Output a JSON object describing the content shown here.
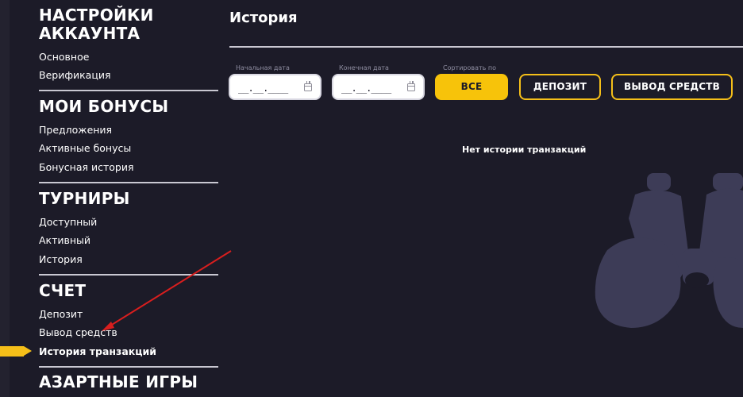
{
  "sidebar": {
    "sections": [
      {
        "title_line1": "НАСТРОЙКИ",
        "title_line2": "АККАУНТА",
        "items": [
          "Основное",
          "Верификация"
        ]
      },
      {
        "title": "МОИ БОНУСЫ",
        "items": [
          "Предложения",
          "Активные бонусы",
          "Бонусная история"
        ]
      },
      {
        "title": "ТУРНИРЫ",
        "items": [
          "Доступный",
          "Активный",
          "История"
        ]
      },
      {
        "title": "СЧЕТ",
        "items": [
          "Депозит",
          "Вывод средств",
          "История транзакций"
        ]
      },
      {
        "title": "АЗАРТНЫЕ ИГРЫ"
      }
    ],
    "active_item": "История транзакций"
  },
  "main": {
    "title": "История",
    "filters": {
      "start_date_label": "Начальная дата",
      "start_date_value": "__.__.____",
      "end_date_label": "Конечная дата",
      "end_date_value": "__.__.____",
      "sort_label": "Сортировать по",
      "buttons": [
        "ВСЕ",
        "ДЕПОЗИТ",
        "ВЫВОД СРЕДСТВ"
      ],
      "selected": "ВСЕ"
    },
    "empty_message": "Нет истории транзакций"
  },
  "colors": {
    "background": "#1c1b28",
    "accent": "#f7c30a",
    "illustration": "#3d3c57",
    "annotation_arrow": "#d81e1e"
  },
  "icons": [
    "calendar-icon",
    "binoculars-illustration",
    "active-item-arrow"
  ]
}
